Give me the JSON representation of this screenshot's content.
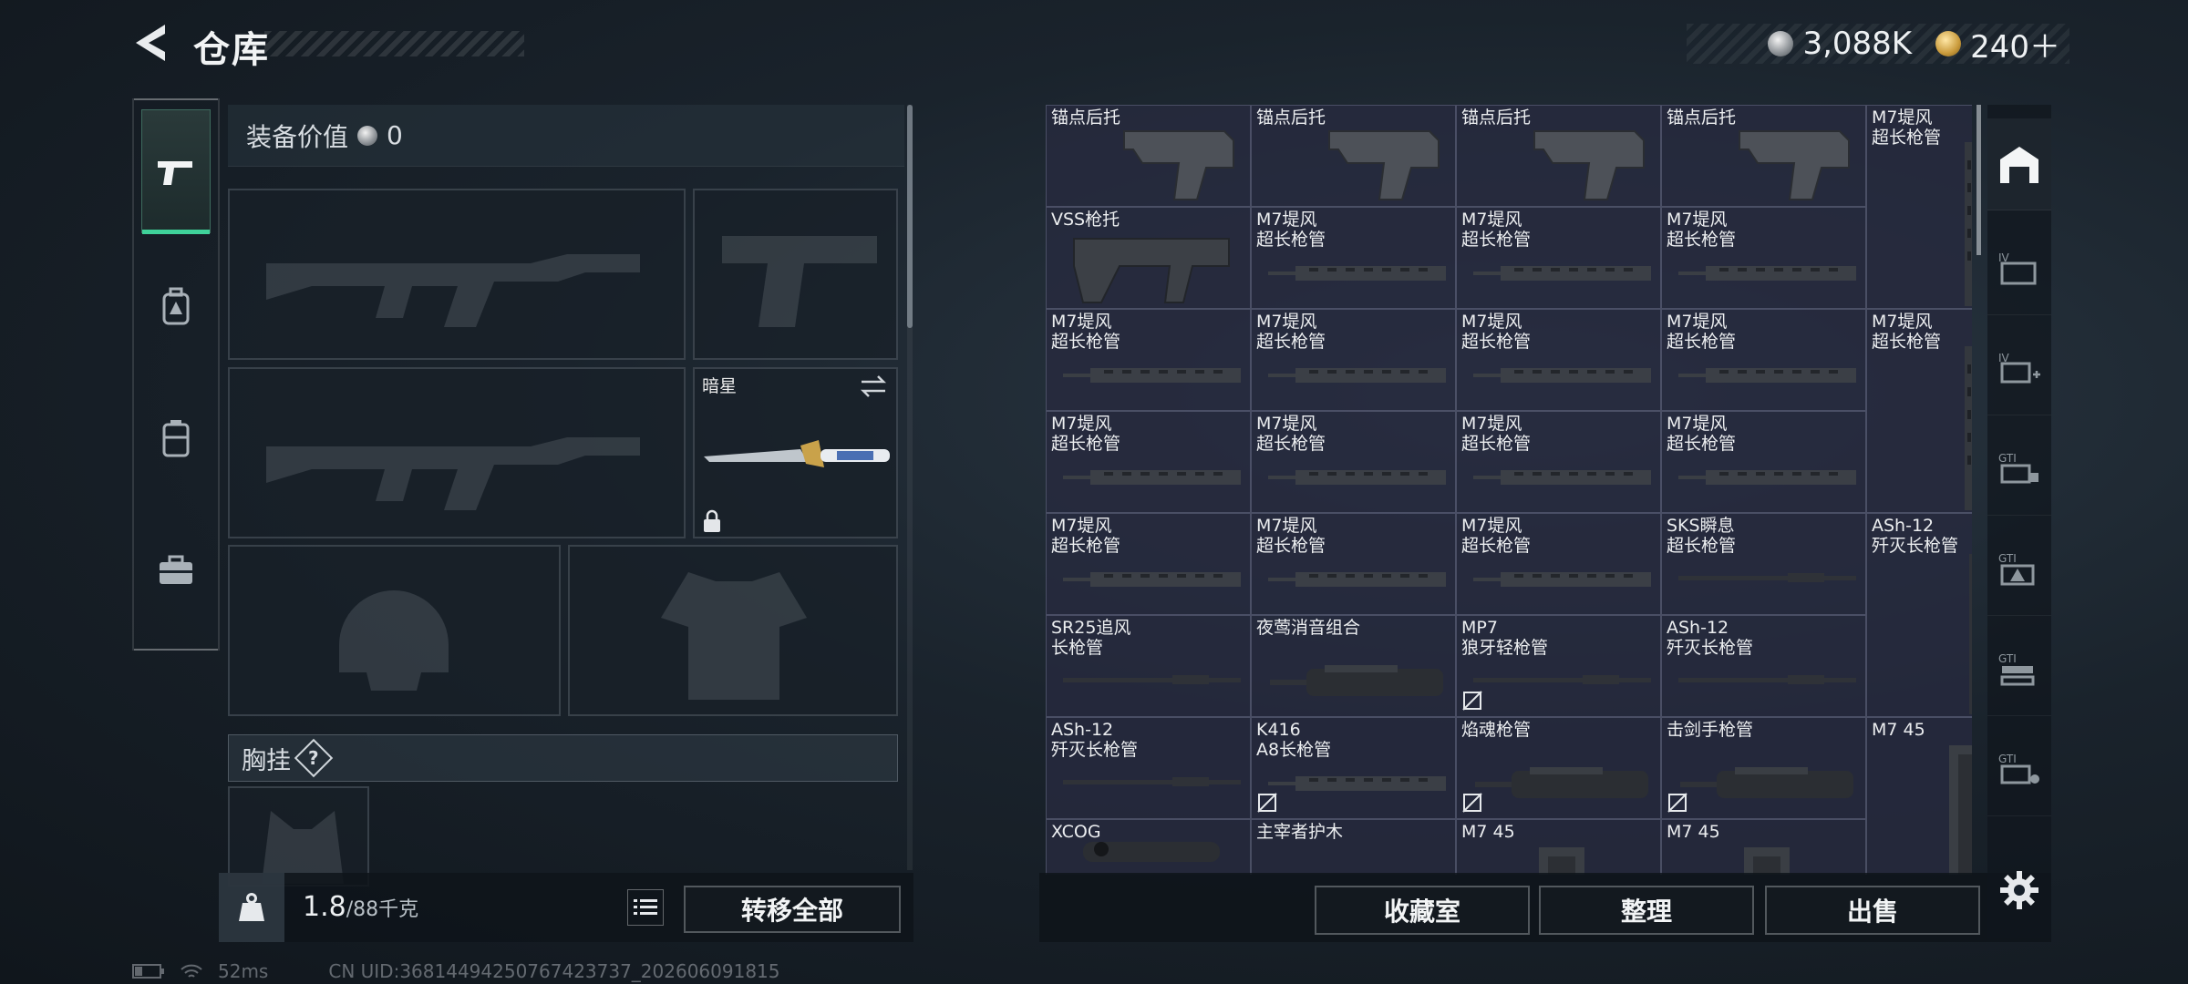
{
  "header": {
    "title": "仓库",
    "currencies": [
      {
        "icon": "silver-coin-icon",
        "value": "3,088K"
      },
      {
        "icon": "gold-coin-icon",
        "value": "240＋"
      }
    ]
  },
  "categories": [
    {
      "icon": "pistol-icon",
      "active": true
    },
    {
      "icon": "backpack-icon",
      "active": false
    },
    {
      "icon": "vest-icon",
      "active": false
    },
    {
      "icon": "toolbox-icon",
      "active": false
    }
  ],
  "equipment": {
    "value_label": "装备价值",
    "value": "0",
    "melee_name": "暗星",
    "chest_rig_label": "胸挂",
    "help_symbol": "?"
  },
  "footer_left": {
    "weight_current": "1.8",
    "weight_max": "/88千克",
    "transfer_all_label": "转移全部"
  },
  "grid": {
    "items": [
      {
        "name": "锚点后托",
        "art": "stock"
      },
      {
        "name": "锚点后托",
        "art": "stock"
      },
      {
        "name": "锚点后托",
        "art": "stock"
      },
      {
        "name": "锚点后托",
        "art": "stock"
      },
      {
        "name": "M7堤风\n超长枪管",
        "art": "vbarrel",
        "tall": true
      },
      {
        "name": "VSS枪托",
        "art": "vss"
      },
      {
        "name": "M7堤风\n超长枪管",
        "art": "barrel"
      },
      {
        "name": "M7堤风\n超长枪管",
        "art": "barrel"
      },
      {
        "name": "M7堤风\n超长枪管",
        "art": "barrel"
      },
      {
        "name": "M7堤风\n超长枪管",
        "art": "barrel"
      },
      {
        "name": "M7堤风\n超长枪管",
        "art": "barrel"
      },
      {
        "name": "M7堤风\n超长枪管",
        "art": "barrel"
      },
      {
        "name": "M7堤风\n超长枪管",
        "art": "barrel"
      },
      {
        "name": "M7堤风\n超长枪管",
        "art": "vbarrel",
        "tall": true
      },
      {
        "name": "M7堤风\n超长枪管",
        "art": "barrel"
      },
      {
        "name": "M7堤风\n超长枪管",
        "art": "barrel"
      },
      {
        "name": "M7堤风\n超长枪管",
        "art": "barrel"
      },
      {
        "name": "M7堤风\n超长枪管",
        "art": "barrel"
      },
      {
        "name": "M7堤风\n超长枪管",
        "art": "barrel"
      },
      {
        "name": "M7堤风\n超长枪管",
        "art": "barrel"
      },
      {
        "name": "M7堤风\n超长枪管",
        "art": "barrel"
      },
      {
        "name": "SKS瞬息\n超长枪管",
        "art": "thin"
      },
      {
        "name": "ASh-12\n歼灭长枪管",
        "art": "vthin",
        "tall": true
      },
      {
        "name": "SR25追风\n长枪管",
        "art": "thin"
      },
      {
        "name": "夜莺消音组合",
        "art": "suppressor"
      },
      {
        "name": "MP7\n狼牙轻枪管",
        "art": "thin",
        "nosell": true
      },
      {
        "name": "ASh-12\n歼灭长枪管",
        "art": "thin"
      },
      {
        "name": "ASh-12\n歼灭长枪管",
        "art": "thin"
      },
      {
        "name": "K416\nA8长枪管",
        "art": "barrel",
        "nosell": true
      },
      {
        "name": "焰魂枪管",
        "art": "suppressor",
        "nosell": true
      },
      {
        "name": "击剑手枪管",
        "art": "suppressor",
        "nosell": true
      },
      {
        "name": "M7 45",
        "art": "mag",
        "tall": true
      },
      {
        "name": "XCOG",
        "art": "scope"
      },
      {
        "name": "主宰者护木",
        "art": "barrel"
      },
      {
        "name": "M7 45",
        "art": "mag"
      },
      {
        "name": "M7 45",
        "art": "mag"
      }
    ]
  },
  "footer_right": {
    "collection_label": "收藏室",
    "organize_label": "整理",
    "sell_label": "出售"
  },
  "rail": [
    {
      "icon": "warehouse-icon",
      "active": true
    },
    {
      "icon": "folder-iv-icon"
    },
    {
      "icon": "add-iv-icon"
    },
    {
      "icon": "gti-cube-icon"
    },
    {
      "icon": "gti-triangle-icon"
    },
    {
      "icon": "gti-stack-icon"
    },
    {
      "icon": "gti-tag-icon"
    }
  ],
  "status": {
    "ping": "52ms",
    "uid": "CN UID:3681449425076742373​7_202606091815"
  }
}
